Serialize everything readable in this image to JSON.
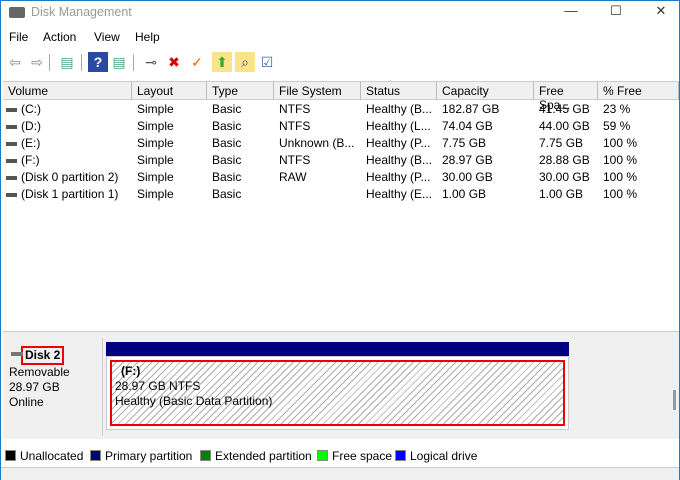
{
  "window": {
    "title": "Disk Management",
    "minimize": "—",
    "maximize": "☐",
    "close": "✕"
  },
  "menu": [
    "File",
    "Action",
    "View",
    "Help"
  ],
  "toolbar": [
    {
      "name": "back-icon",
      "glyph": "⇦",
      "color": "#888"
    },
    {
      "name": "forward-icon",
      "glyph": "⇨",
      "color": "#888"
    },
    {
      "name": "show-hide-console-tree-icon",
      "glyph": "▤",
      "color": "#4a7"
    },
    {
      "name": "help-icon",
      "glyph": "?",
      "color": "#fff"
    },
    {
      "name": "show-hide-action-pane-icon",
      "glyph": "▤",
      "color": "#4a7"
    },
    {
      "name": "connect-virtual-disk-icon",
      "glyph": "⊸",
      "color": "#555"
    },
    {
      "name": "delete-icon",
      "glyph": "✖",
      "color": "#d00"
    },
    {
      "name": "properties-icon",
      "glyph": "✓",
      "color": "#e60"
    },
    {
      "name": "import-icon",
      "glyph": "⬆",
      "color": "#3a3"
    },
    {
      "name": "explore-icon",
      "glyph": "⌕",
      "color": "#357"
    },
    {
      "name": "settings-icon",
      "glyph": "☑",
      "color": "#46a"
    }
  ],
  "table": {
    "columns": [
      "Volume",
      "Layout",
      "Type",
      "File System",
      "Status",
      "Capacity",
      "Free Spa...",
      "% Free"
    ],
    "rows": [
      [
        "(C:)",
        "Simple",
        "Basic",
        "NTFS",
        "Healthy (B...",
        "182.87 GB",
        "41.45 GB",
        "23 %"
      ],
      [
        "(D:)",
        "Simple",
        "Basic",
        "NTFS",
        "Healthy (L...",
        "74.04 GB",
        "44.00 GB",
        "59 %"
      ],
      [
        "(E:)",
        "Simple",
        "Basic",
        "Unknown (B...",
        "Healthy (P...",
        "7.75 GB",
        "7.75 GB",
        "100 %"
      ],
      [
        "(F:)",
        "Simple",
        "Basic",
        "NTFS",
        "Healthy (B...",
        "28.97 GB",
        "28.88 GB",
        "100 %"
      ],
      [
        "(Disk 0 partition 2)",
        "Simple",
        "Basic",
        "RAW",
        "Healthy (P...",
        "30.00 GB",
        "30.00 GB",
        "100 %"
      ],
      [
        "(Disk 1 partition 1)",
        "Simple",
        "Basic",
        "",
        "Healthy (E...",
        "1.00 GB",
        "1.00 GB",
        "100 %"
      ]
    ]
  },
  "disk": {
    "label": "Disk 2",
    "type": "Removable",
    "size": "28.97 GB",
    "state": "Online",
    "partition": {
      "name": "(F:)",
      "size_fs": "28.97 GB NTFS",
      "status": "Healthy (Basic Data Partition)"
    }
  },
  "legend": [
    {
      "label": "Unallocated",
      "color": "#000000"
    },
    {
      "label": "Primary partition",
      "color": "#000080"
    },
    {
      "label": "Extended partition",
      "color": "#008000"
    },
    {
      "label": "Free space",
      "color": "#00ff00"
    },
    {
      "label": "Logical drive",
      "color": "#0000ff"
    }
  ]
}
